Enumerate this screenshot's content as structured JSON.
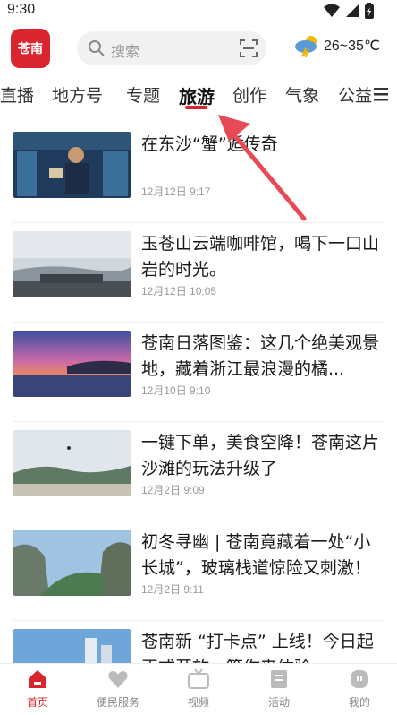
{
  "status": {
    "time": "9:30"
  },
  "header": {
    "logo_text": "苍南",
    "search_placeholder": "搜索",
    "weather": "26~35℃"
  },
  "tabs": [
    {
      "label": "直播"
    },
    {
      "label": "地方号"
    },
    {
      "label": "专题"
    },
    {
      "label": "旅游",
      "active": true
    },
    {
      "label": "创作"
    },
    {
      "label": "气象"
    },
    {
      "label": "公益"
    }
  ],
  "feed": [
    {
      "title": "在东沙“蟹”逅传奇",
      "date": "12月12日 9:17"
    },
    {
      "title": "玉苍山云端咖啡馆，喝下一口山岩的时光。",
      "date": "12月12日 10:05"
    },
    {
      "title": "苍南日落图鉴：这几个绝美观景地，藏着浙江最浪漫的橘...",
      "date": "12月10日 9:10"
    },
    {
      "title": "一键下单，美食空降！苍南这片沙滩的玩法升级了",
      "date": "12月2日 9:09"
    },
    {
      "title": "初冬寻幽 | 苍南竟藏着一处“小长城”，玻璃栈道惊险又刺激！",
      "date": "12月2日 9:11"
    },
    {
      "title": "苍南新 “打卡点” 上线！今日起正式开放，等你来体验",
      "date": ""
    }
  ],
  "bottom_nav": [
    {
      "label": "首页",
      "icon": "home-icon",
      "active": true
    },
    {
      "label": "便民服务",
      "icon": "heart-icon"
    },
    {
      "label": "视频",
      "icon": "tv-icon"
    },
    {
      "label": "活动",
      "icon": "flag-icon"
    },
    {
      "label": "我的",
      "icon": "profile-icon"
    }
  ],
  "colors": {
    "accent": "#d9262e",
    "arrow": "#e84a55"
  }
}
